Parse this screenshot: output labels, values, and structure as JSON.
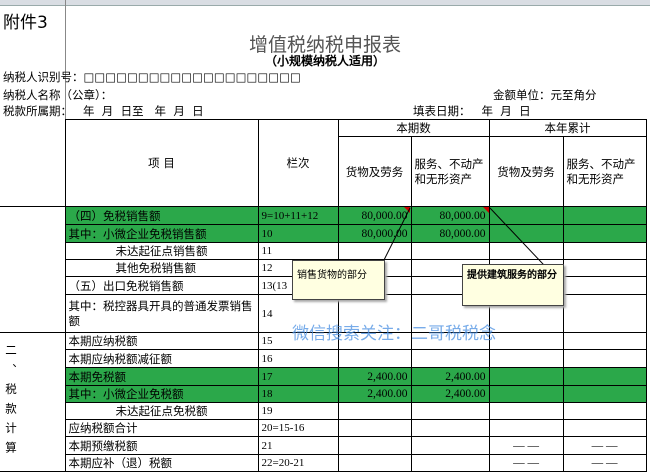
{
  "attachment": "附件3",
  "title": "增值税纳税申报表",
  "subtitle": "（小规模纳税人适用）",
  "taxpayer_id_label": "纳税人识别号：□□□□□□□□□□□□□□□□□□□□",
  "taxpayer_name_label": "纳税人名称（公章）：",
  "unit_label": "金额单位：元至角分",
  "period_label": "税款所属期：   年  月  日至   年  月  日",
  "fill_date_label": "填表日期：   年  月  日",
  "headers": {
    "item": "项  目",
    "col": "栏次",
    "current": "本期数",
    "ytd": "本年累计",
    "goods": "货物及劳务",
    "services": "服务、不动产和无形资产"
  },
  "section2": "二、税款计算",
  "rows": [
    {
      "item": "（四）免税销售额",
      "code": "9=10+11+12",
      "v1": "80,000.00",
      "v2": "80,000.00",
      "v3": "",
      "v4": ""
    },
    {
      "item": "其中：小微企业免税销售额",
      "code": "10",
      "v1": "80,000.00",
      "v2": "80,000.00",
      "v3": "",
      "v4": ""
    },
    {
      "item": "未达起征点销售额",
      "code": "11",
      "v1": "",
      "v2": "",
      "v3": "",
      "v4": ""
    },
    {
      "item": "其他免税销售额",
      "code": "12",
      "v1": "",
      "v2": "",
      "v3": "",
      "v4": ""
    },
    {
      "item": "（五）出口免税销售额",
      "code": "13(13",
      "v1": "",
      "v2": "",
      "v3": "",
      "v4": ""
    },
    {
      "item": "其中：税控器具开具的普通发票销售额",
      "code": "14",
      "v1": "",
      "v2": "",
      "v3": "",
      "v4": ""
    },
    {
      "item": "本期应纳税额",
      "code": "15",
      "v1": "",
      "v2": "",
      "v3": "",
      "v4": ""
    },
    {
      "item": "本期应纳税额减征额",
      "code": "16",
      "v1": "",
      "v2": "",
      "v3": "",
      "v4": ""
    },
    {
      "item": "本期免税额",
      "code": "17",
      "v1": "2,400.00",
      "v2": "2,400.00",
      "v3": "",
      "v4": ""
    },
    {
      "item": "其中：小微企业免税额",
      "code": "18",
      "v1": "2,400.00",
      "v2": "2,400.00",
      "v3": "",
      "v4": ""
    },
    {
      "item": "未达起征点免税额",
      "code": "19",
      "v1": "",
      "v2": "",
      "v3": "",
      "v4": ""
    },
    {
      "item": "应纳税额合计",
      "code": "20=15-16",
      "v1": "",
      "v2": "",
      "v3": "",
      "v4": ""
    },
    {
      "item": "本期预缴税额",
      "code": "21",
      "v1": "",
      "v2": "",
      "v3": "— —",
      "v4": "— —"
    },
    {
      "item": "本期应补（退）税额",
      "code": "22=20-21",
      "v1": "",
      "v2": "",
      "v3": "— —",
      "v4": "— —"
    }
  ],
  "notes": {
    "goods": "销售货物的部分",
    "services": "提供建筑服务的部分"
  },
  "watermark": "微信搜索关注：二哥税税念",
  "colors": {
    "highlight": "#2ba84a",
    "note_bg": "#ffffe1"
  }
}
